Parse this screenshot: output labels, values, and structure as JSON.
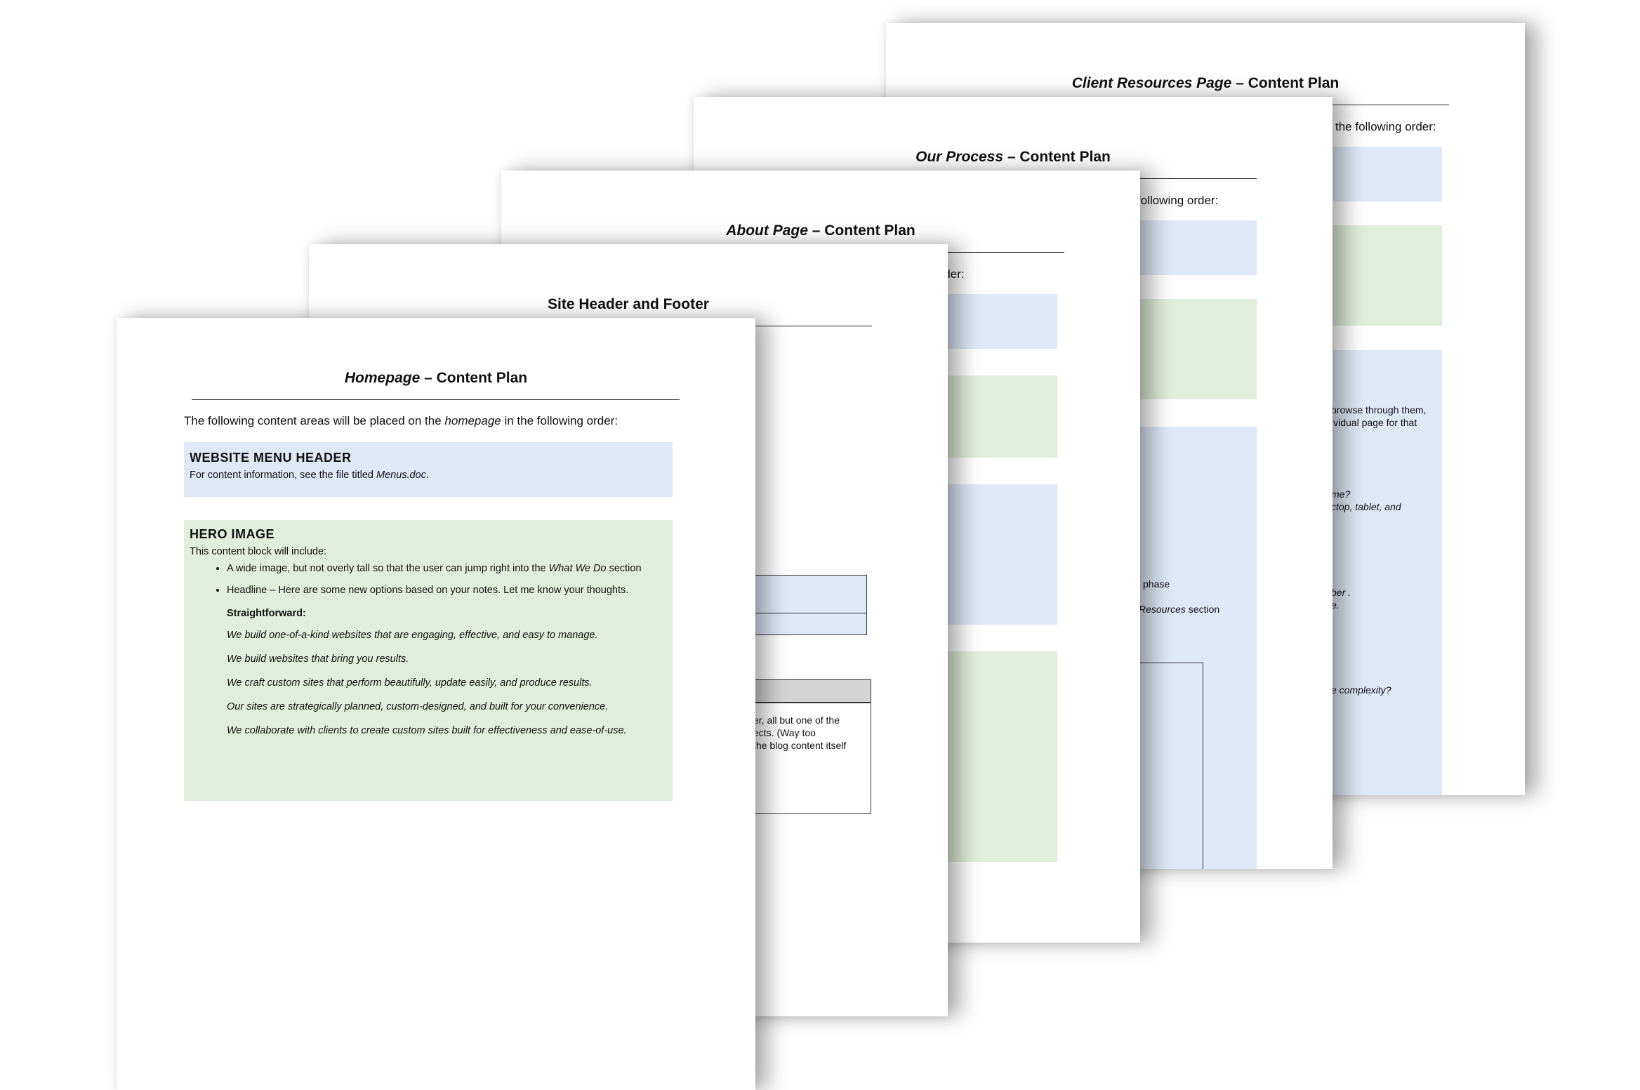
{
  "pages": {
    "client_resources": {
      "title_em": "Client Resources Page",
      "title_rest": " – Content Plan",
      "intro_fragment": "the following order:",
      "frag_browse_1": "browse through them,",
      "frag_browse_2": "ividual page for that",
      "frag_me": "me?",
      "frag_ctop": "ctop, tablet, and",
      "frag_ber": "ber .",
      "frag_e": "e.",
      "frag_complexity": "e complexity?"
    },
    "our_process": {
      "title_em": "Our Process",
      "title_rest": " – Content Plan",
      "intro_fragment": "following order:",
      "frag_phase": "phase",
      "frag_resources_em": "Resources",
      "frag_resources_rest": " section"
    },
    "about": {
      "title_em": "About Page",
      "title_rest": " – Content Plan",
      "intro_fragment": "g order:",
      "frag_er_1": "er, all but one of the",
      "frag_er_2": "ects. (Way too",
      "frag_er_3": "the blog content itself"
    },
    "site_header_footer": {
      "title": "Site Header and Footer"
    },
    "homepage": {
      "title_em": "Homepage",
      "title_rest": " – Content Plan",
      "intro_before": "The following content areas will be placed on the ",
      "intro_em": "homepage",
      "intro_after": " in the following order:",
      "menu_heading": "WEBSITE MENU HEADER",
      "menu_text_before": "For content information, see the file titled ",
      "menu_text_em": "Menus.doc",
      "menu_text_after": ".",
      "hero_heading": "HERO IMAGE",
      "hero_text": "This content block will include:",
      "bullet1_before": "A wide image, but not overly tall so that the user can jump right into the ",
      "bullet1_em": "What We Do",
      "bullet1_after": " section",
      "bullet2": "Headline – Here are some new options based on your notes. Let me know your thoughts.",
      "option_label": "Straightforward:",
      "options": [
        "We build one-of-a-kind websites that are engaging, effective, and easy to manage.",
        "We build websites that bring you results.",
        "We craft custom sites that perform beautifully, update easily, and produce results.",
        "Our sites are strategically planned, custom-designed, and built for your convenience.",
        "We collaborate with clients to create custom sites built for effectiveness and ease-of-use."
      ]
    }
  },
  "colors": {
    "blue_block": "#dfe8f6",
    "green_block": "#e1eedb"
  }
}
